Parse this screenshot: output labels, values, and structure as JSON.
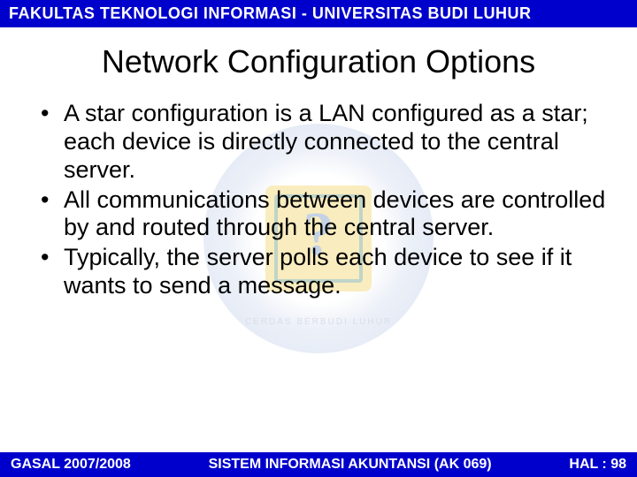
{
  "header": "FAKULTAS TEKNOLOGI INFORMASI - UNIVERSITAS BUDI LUHUR",
  "title": "Network Configuration Options",
  "bullets": [
    "A star configuration is a LAN configured as a star; each device is directly connected to the central server.",
    "All communications between devices are controlled by and routed through the central server.",
    "Typically, the server polls each device to see if it wants to send a message."
  ],
  "watermark": {
    "motto": "CERDAS BERBUDI LUHUR"
  },
  "footer": {
    "left": "GASAL 2007/2008",
    "center": "SISTEM INFORMASI AKUNTANSI (AK 069)",
    "right": "HAL : 98"
  }
}
